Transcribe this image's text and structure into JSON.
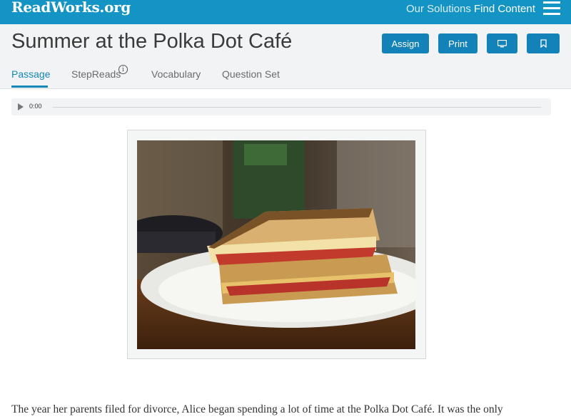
{
  "topbar": {
    "logo": "ReadWorks.org",
    "nav": {
      "solutions": "Our Solutions",
      "find_content": "Find Content"
    }
  },
  "header": {
    "title": "Summer at the Polka Dot Café",
    "buttons": {
      "assign": "Assign",
      "print": "Print"
    },
    "icons": {
      "present": "monitor-icon",
      "save": "bookmark-icon",
      "info": "info-icon"
    },
    "tabs": [
      "Passage",
      "StepReads",
      "Vocabulary",
      "Question Set"
    ],
    "active_tab": "Passage"
  },
  "audio": {
    "time": "0:00"
  },
  "passage": {
    "first_line": "The year her parents filed for divorce, Alice began spending a lot of time at the Polka Dot Café. It was the only"
  },
  "colors": {
    "brand": "#1494c4",
    "button": "#1382b9",
    "active_tab": "#1487b7"
  }
}
